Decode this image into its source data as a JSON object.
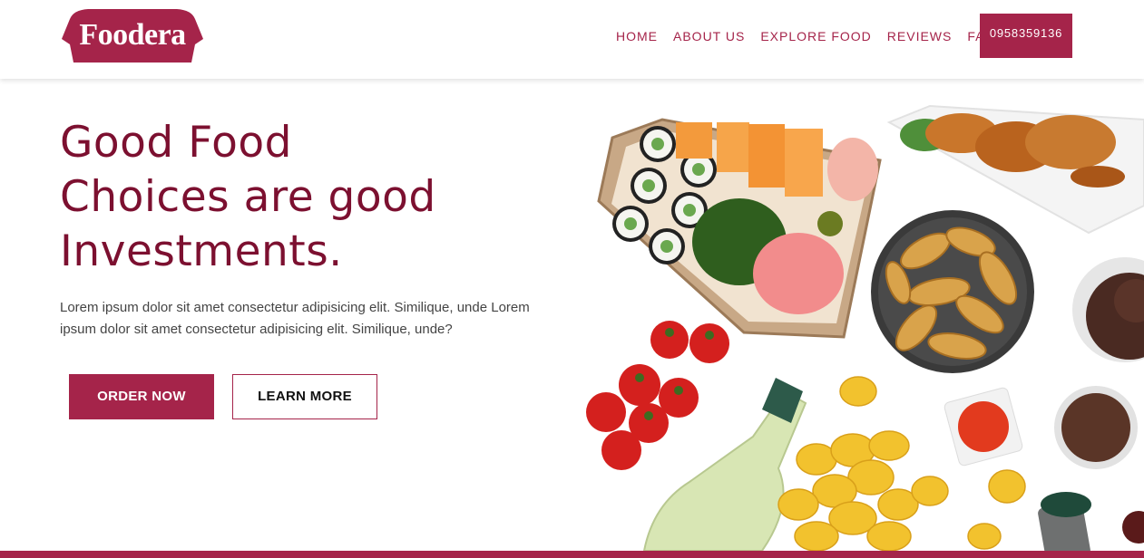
{
  "brand": {
    "name": "Foodera",
    "color": "#a5244a"
  },
  "nav": {
    "items": [
      {
        "label": "HOME"
      },
      {
        "label": "ABOUT US"
      },
      {
        "label": "EXPLORE FOOD"
      },
      {
        "label": "REVIEWS"
      },
      {
        "label": "FAQ"
      }
    ],
    "phone": "0958359136"
  },
  "hero": {
    "title_lines": [
      "Good Food",
      "Choices are good",
      "Investments."
    ],
    "description": "Lorem ipsum dolor sit amet consectetur adipisicing elit. Similique, unde Lorem ipsum dolor sit amet consectetur adipisicing elit. Similique, unde?",
    "order_label": "ORDER NOW",
    "learn_label": "LEARN MORE",
    "image_icon": "food-spread-image"
  }
}
